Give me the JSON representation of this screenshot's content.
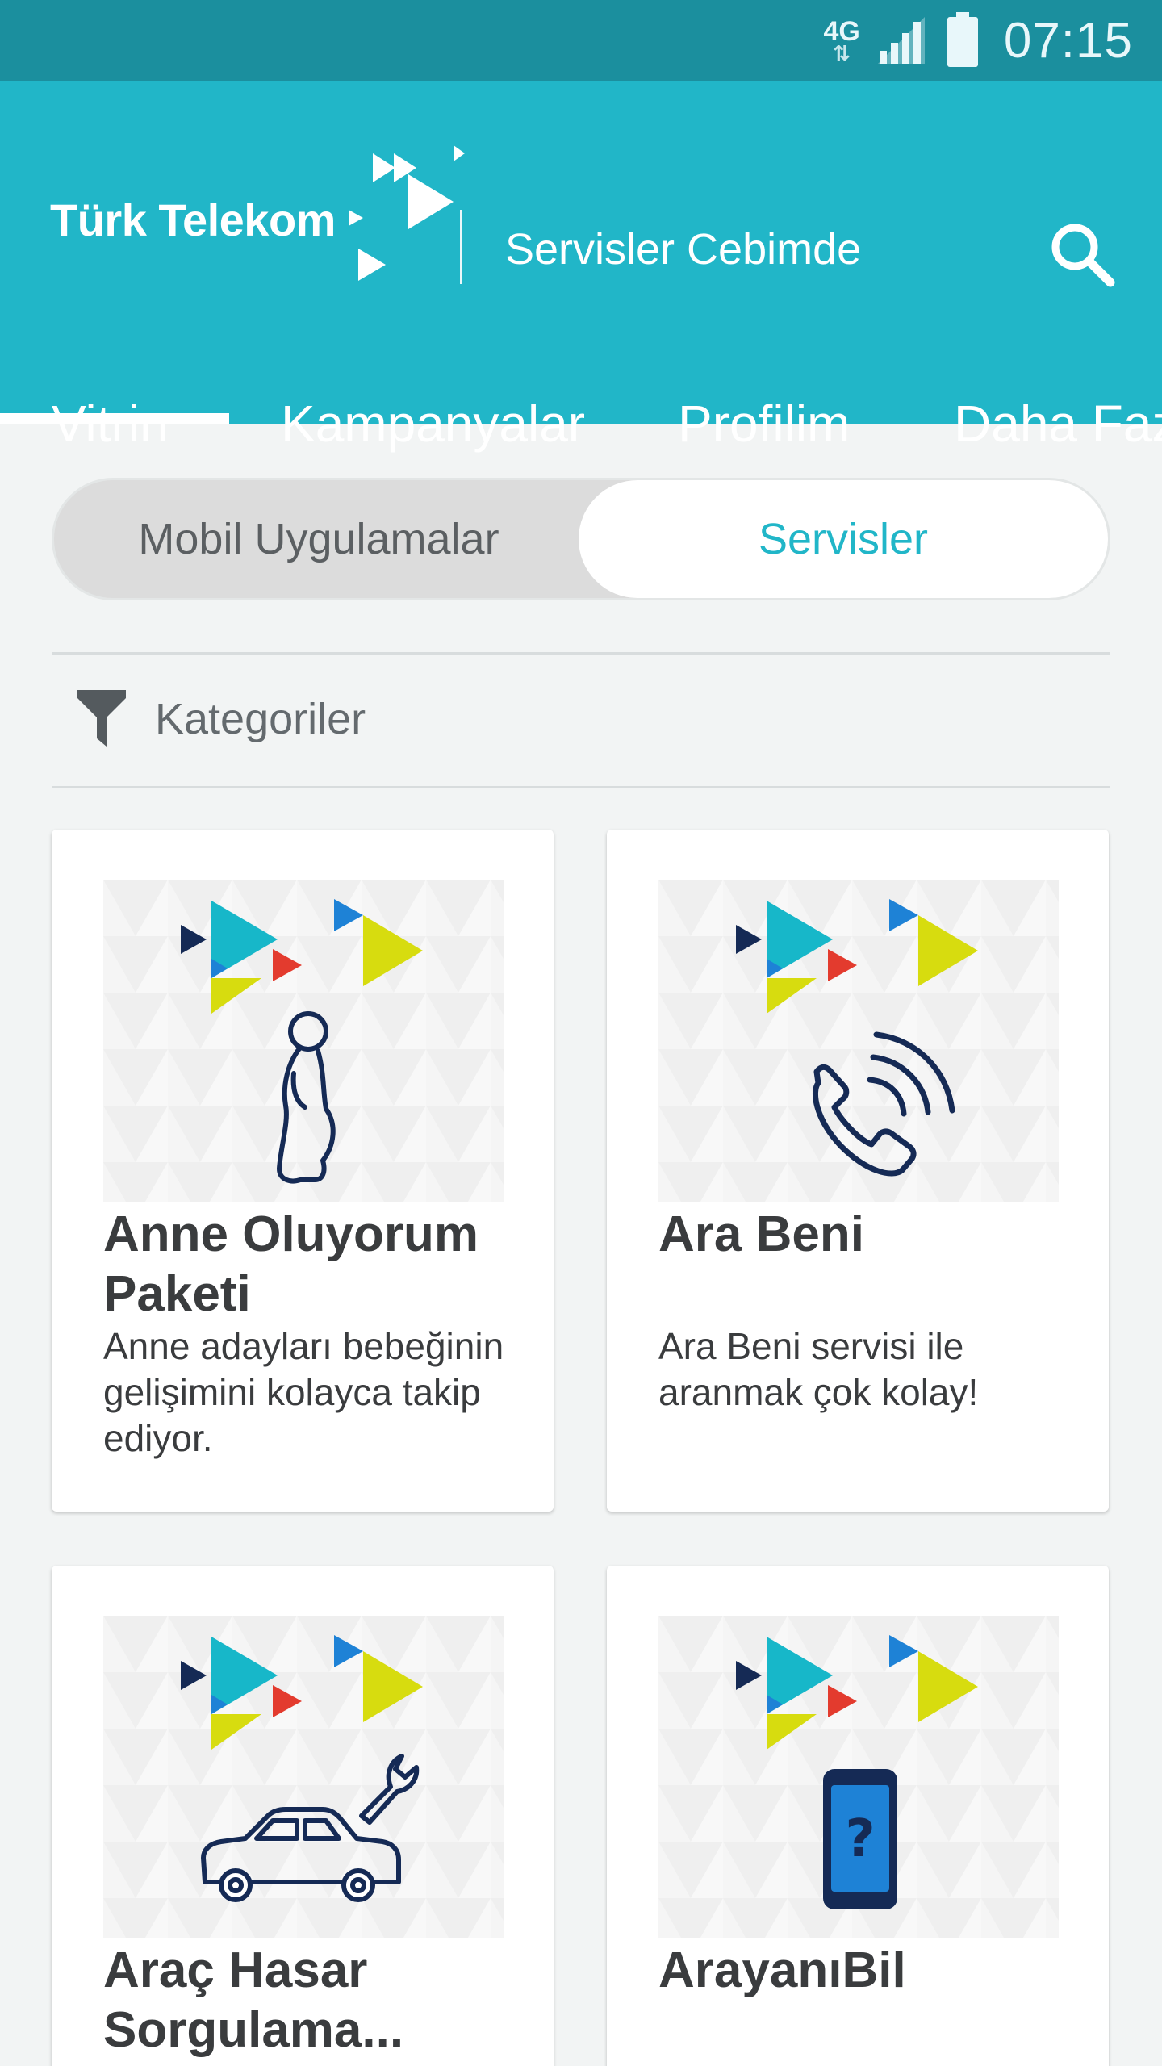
{
  "status_bar": {
    "network": "4G",
    "time": "07:15"
  },
  "header": {
    "logo_text": "Türk Telekom",
    "subtitle": "Servisler Cebimde",
    "search_icon": "search-icon"
  },
  "tabs": [
    {
      "label": "Vitrin",
      "active": true
    },
    {
      "label": "Kampanyalar",
      "active": false
    },
    {
      "label": "Profilim",
      "active": false
    },
    {
      "label": "Daha Fazla",
      "active": false
    }
  ],
  "segment": {
    "left_label": "Mobil Uygulamalar",
    "right_label": "Servisler",
    "selected": "Servisler"
  },
  "filter": {
    "icon": "funnel-icon",
    "label": "Kategoriler"
  },
  "colors": {
    "status_bar": "#1b8f9e",
    "brand_teal": "#21b6c8",
    "navy": "#152a55",
    "yellow": "#d7dc0f",
    "red": "#e33b2e",
    "blue": "#1e82d6"
  },
  "cards": [
    {
      "title": "Anne Oluyorum Paketi",
      "description": "Anne adayları bebeğinin gelişimini kolayca takip ediyor.",
      "icon": "pregnant-woman-icon"
    },
    {
      "title": "Ara Beni",
      "description": "Ara Beni servisi ile aranmak çok kolay!",
      "icon": "phone-call-icon"
    },
    {
      "title": "Araç Hasar Sorgulama...",
      "description": "",
      "icon": "car-wrench-icon"
    },
    {
      "title": "ArayanıBil",
      "description": "",
      "icon": "phone-question-icon"
    }
  ]
}
